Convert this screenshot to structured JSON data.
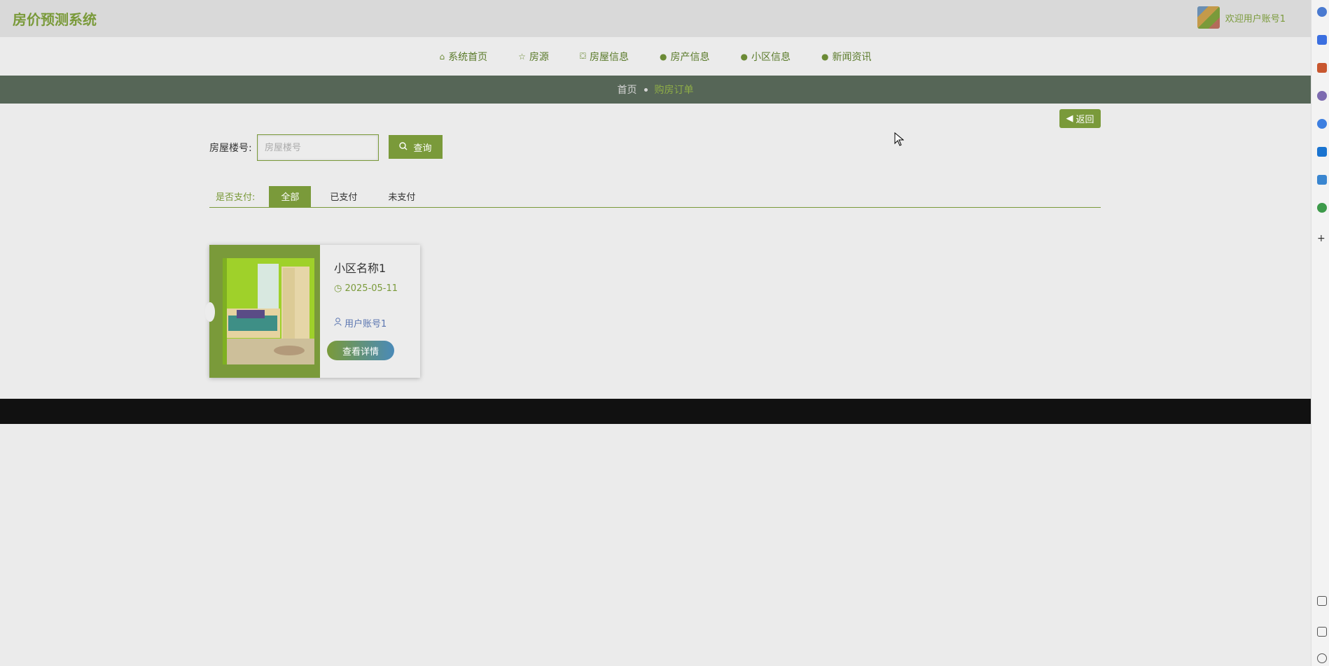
{
  "header": {
    "site_title": "房价预测系统",
    "welcome": "欢迎用户账号1"
  },
  "nav": {
    "items": [
      {
        "label": "系统首页",
        "icon": "home-icon"
      },
      {
        "label": "房源",
        "icon": "star-icon"
      },
      {
        "label": "房屋信息",
        "icon": "bag-icon"
      },
      {
        "label": "房产信息",
        "icon": "info-icon"
      },
      {
        "label": "小区信息",
        "icon": "question-icon"
      },
      {
        "label": "新闻资讯",
        "icon": "info-icon"
      }
    ]
  },
  "breadcrumb": {
    "home": "首页",
    "current": "购房订单"
  },
  "back_label": "返回",
  "search": {
    "label": "房屋楼号:",
    "placeholder": "房屋楼号",
    "button": "查询"
  },
  "filter": {
    "label": "是否支付:",
    "options": [
      "全部",
      "已支付",
      "未支付"
    ],
    "active": "全部"
  },
  "cards": [
    {
      "title": "小区名称1",
      "date": "2025-05-11",
      "user": "用户账号1",
      "button": "查看详情"
    }
  ],
  "colors": {
    "accent": "#7a9a3a",
    "band": "#566657",
    "footer": "#111111"
  }
}
